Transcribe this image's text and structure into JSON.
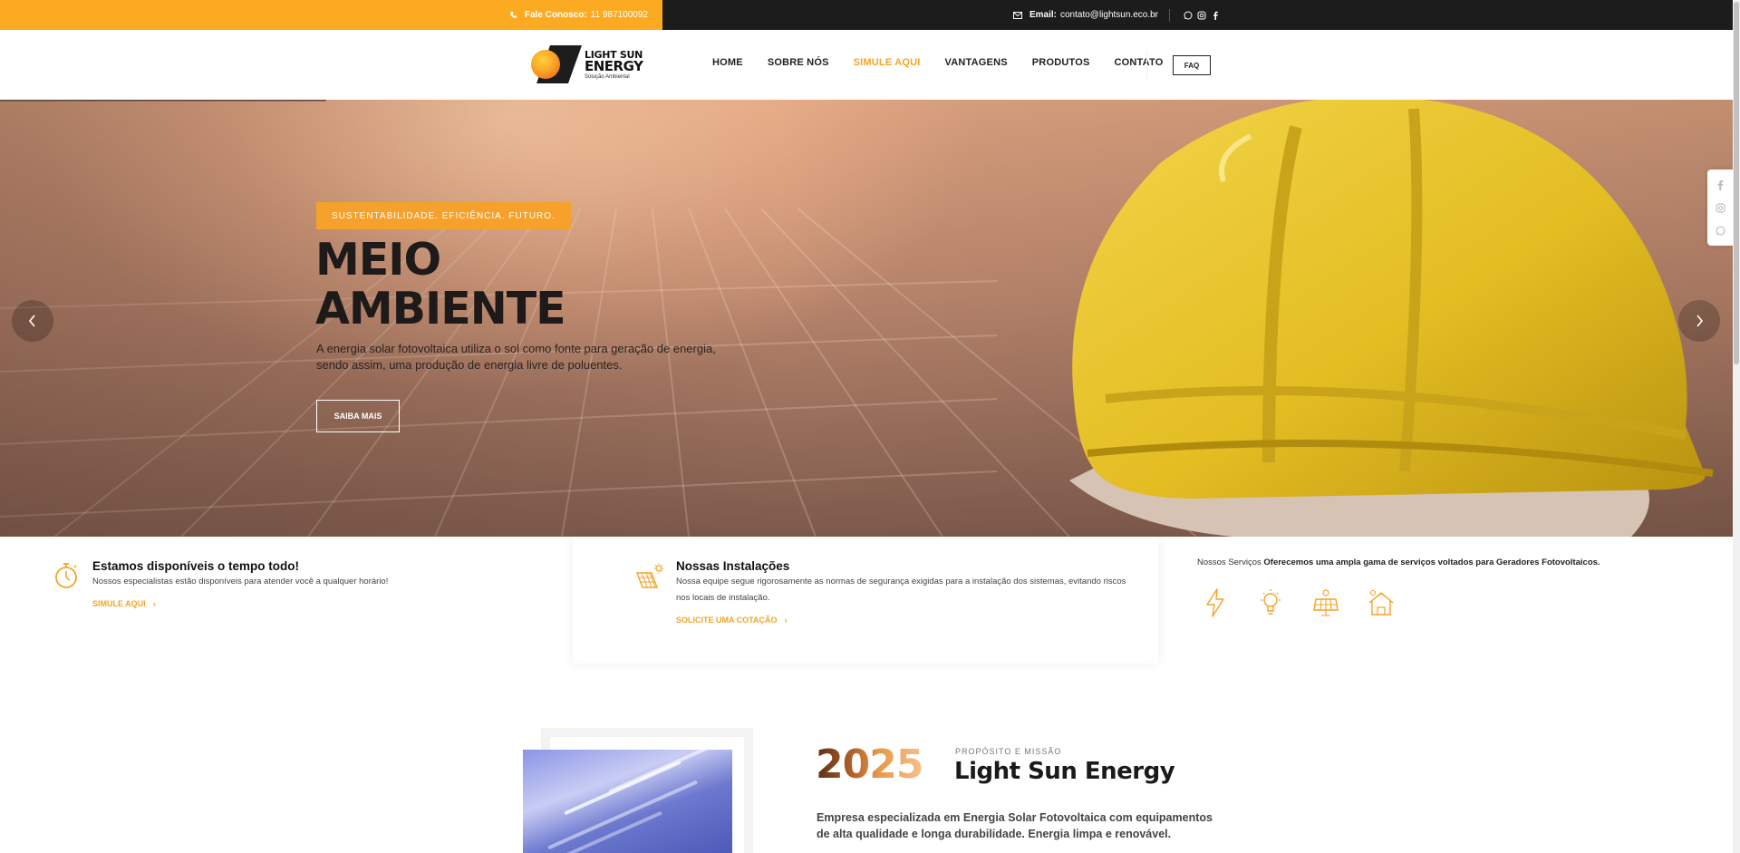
{
  "topbar": {
    "phone_label": "Fale Conosco:",
    "phone_value": "11 987100092",
    "email_label": "Email:",
    "email_value": "contato@lightsun.eco.br",
    "icons": [
      "phone-icon",
      "envelope-icon",
      "whatsapp-icon",
      "instagram-icon",
      "facebook-icon"
    ]
  },
  "header": {
    "logo_line1": "LIGHT SUN",
    "logo_line2": "ENERGY",
    "logo_line3": "Solução Ambiental",
    "nav": [
      "HOME",
      "SOBRE NÓS",
      "SIMULE AQUI",
      "VANTAGENS",
      "PRODUTOS",
      "CONTATO"
    ],
    "active_nav": "SIMULE AQUI",
    "faq": "FAQ"
  },
  "hero": {
    "tag": "SUSTENTABILIDADE. EFICIÊNCIA. FUTURO.",
    "title_line1": "MEIO",
    "title_line2": "AMBIENTE",
    "desc_line1": "A energia solar fotovoltaica utiliza o sol como fonte para geração de energia,",
    "desc_line2": "sendo assim, uma produção de energia livre de poluentes.",
    "button": "SAIBA MAIS"
  },
  "features": {
    "f1": {
      "title": "Estamos disponíveis o tempo todo!",
      "desc": "Nossos especialistas estão disponíveis para atender você a qualquer horário!",
      "link": "SIMULE AQUI"
    },
    "f2": {
      "title": "Nossas Instalações",
      "desc": "Nossa equipe segue rigorosamente as normas de segurança exigidas para a instalação dos sistemas, evitando riscos nos locais de instalação.",
      "link": "SOLICITE UMA COTAÇÃO"
    },
    "f3": {
      "label": "Nossos Serviços",
      "bold": "Oferecemos uma ampla gama de serviços voltados para Geradores Fotovoltaicos.",
      "icons": [
        "lightning-icon",
        "lightbulb-icon",
        "solar-panel-icon",
        "solar-house-icon"
      ]
    }
  },
  "about": {
    "year": "2025",
    "kicker": "PROPÓSITO E MISSÃO",
    "title": "Light Sun Energy",
    "desc": "Empresa especializada em Energia Solar Fotovoltaica com equipamentos de alta qualidade e longa durabilidade. Energia limpa e renovável."
  },
  "colors": {
    "accent": "#fdaa23",
    "dark": "#1c1c1c",
    "helmet": "#e8c426"
  }
}
